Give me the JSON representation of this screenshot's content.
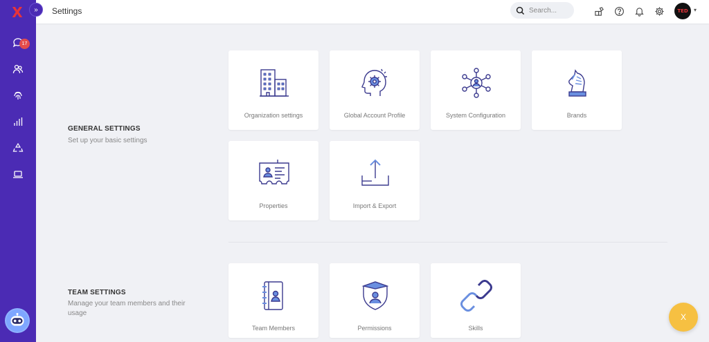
{
  "app": {
    "logo": "X",
    "collapse_icon": "»"
  },
  "sidebar": {
    "badge_count": "17",
    "items": [
      {
        "name": "chat-icon"
      },
      {
        "name": "contacts-icon"
      },
      {
        "name": "fingerprint-icon"
      },
      {
        "name": "reports-icon"
      },
      {
        "name": "recycle-icon"
      },
      {
        "name": "laptop-icon"
      }
    ]
  },
  "topbar": {
    "title": "Settings",
    "search_placeholder": "Search...",
    "avatar_text": "TED"
  },
  "general": {
    "title": "GENERAL SETTINGS",
    "description": "Set up your basic settings",
    "cards": [
      {
        "label": "Organization settings"
      },
      {
        "label": "Global Account Profile"
      },
      {
        "label": "System Configuration"
      },
      {
        "label": "Brands"
      },
      {
        "label": "Properties"
      },
      {
        "label": "Import & Export"
      }
    ]
  },
  "team": {
    "title": "TEAM SETTINGS",
    "description": "Manage your team members and their usage",
    "cards": [
      {
        "label": "Team Members"
      },
      {
        "label": "Permissions"
      },
      {
        "label": "Skills"
      }
    ]
  },
  "fab": {
    "label": "X"
  },
  "colors": {
    "sidebar": "#4b2bb4",
    "accent": "#4b2bb4",
    "icon_blue": "#6a8fe0",
    "fab": "#f6c042"
  }
}
